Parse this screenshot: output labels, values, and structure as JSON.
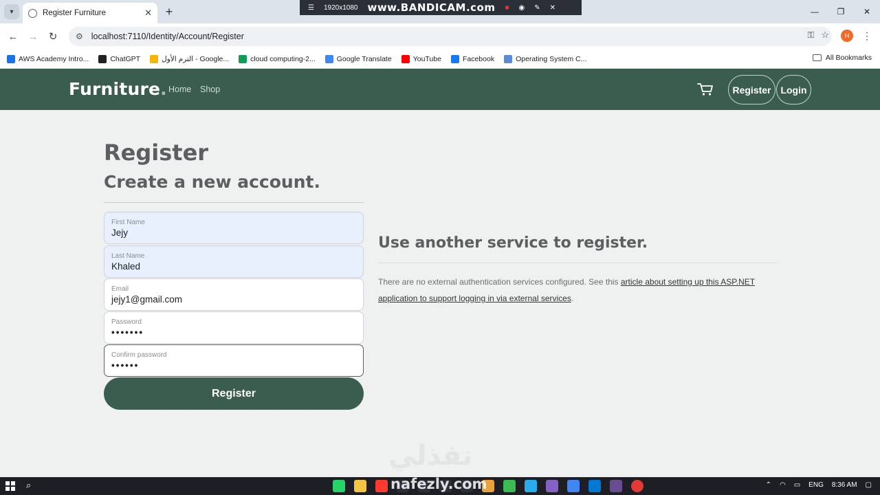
{
  "browser": {
    "tab_title": "Register Furniture",
    "tab_close": "✕",
    "new_tab": "+",
    "url": "localhost:7110/Identity/Account/Register",
    "profile_initial": "H",
    "recording_resolution": "1920x1080",
    "recording_brand": "www.BANDICAM.com"
  },
  "bookmarks": [
    {
      "label": "AWS Academy Intro...",
      "color": "#1a73e8"
    },
    {
      "label": "ChatGPT",
      "color": "#222222"
    },
    {
      "label": "الترم الأول - Google...",
      "color": "#f4b400"
    },
    {
      "label": "cloud computing-2...",
      "color": "#0f9d58"
    },
    {
      "label": "Google Translate",
      "color": "#4285f4"
    },
    {
      "label": "YouTube",
      "color": "#ff0000"
    },
    {
      "label": "Facebook",
      "color": "#1877f2"
    },
    {
      "label": "Operating System C...",
      "color": "#5b8dd6"
    }
  ],
  "bookmarks_all": "All Bookmarks",
  "site": {
    "brand": "Furniture",
    "brand_dot": ".",
    "nav_home": "Home",
    "nav_shop": "Shop",
    "register_btn": "Register",
    "login_btn": "Login",
    "colors": {
      "primary": "#3b5d50"
    }
  },
  "form": {
    "title": "Register",
    "subtitle": "Create a new account.",
    "first_name_label": "First Name",
    "first_name_value": "Jejy",
    "last_name_label": "Last Name",
    "last_name_value": "Khaled",
    "email_label": "Email",
    "email_value": "jejy1@gmail.com",
    "password_label": "Password",
    "password_value": "•••••••",
    "confirm_label": "Confirm password",
    "confirm_value": "••••••",
    "submit": "Register"
  },
  "external": {
    "title": "Use another service to register.",
    "text": "There are no external authentication services configured. See this ",
    "link": "article about setting up this ASP.NET application to support logging in via external services",
    "suffix": "."
  },
  "watermark": {
    "arabic": "نفذلي",
    "latin": "nafezly.com"
  },
  "taskbar": {
    "lang": "ENG",
    "time": "8:36 AM"
  }
}
